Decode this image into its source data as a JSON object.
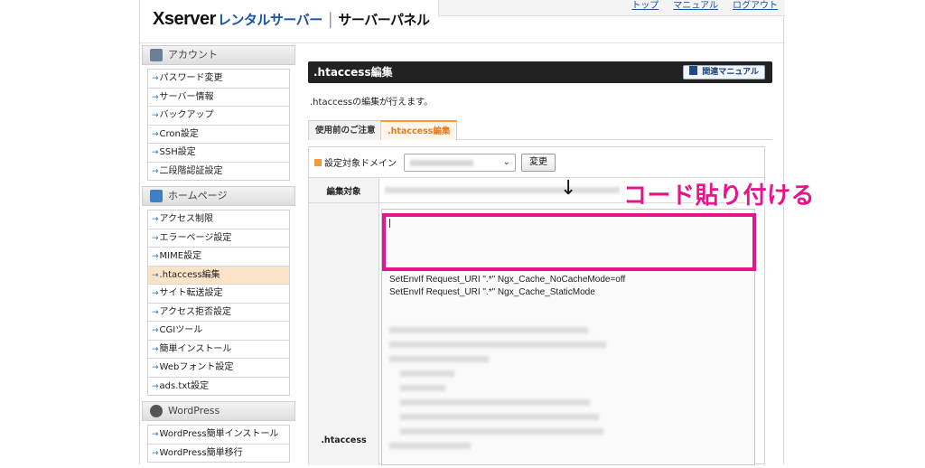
{
  "header": {
    "brand": "Xserver",
    "rental": "レンタルサーバー",
    "separator": "|",
    "panel": "サーバーパネル",
    "nav": [
      "トップ",
      "マニュアル",
      "ログアウト"
    ]
  },
  "sidebar": {
    "groups": [
      {
        "title": "アカウント",
        "icon": "account-icon",
        "items": [
          "パスワード変更",
          "サーバー情報",
          "バックアップ",
          "Cron設定",
          "SSH設定",
          "二段階認証設定"
        ]
      },
      {
        "title": "ホームページ",
        "icon": "homepage-icon",
        "items": [
          "アクセス制限",
          "エラーページ設定",
          "MIME設定",
          ".htaccess編集",
          "サイト転送設定",
          "アクセス拒否設定",
          "CGIツール",
          "簡単インストール",
          "Webフォント設定",
          "ads.txt設定"
        ],
        "active_index": 3
      },
      {
        "title": "WordPress",
        "icon": "wordpress-icon",
        "items": [
          "WordPress簡単インストール",
          "WordPress簡単移行"
        ]
      }
    ]
  },
  "main": {
    "title": ".htaccess編集",
    "manual_button": "関連マニュアル",
    "description": ".htaccessの編集が行えます。",
    "tabs": [
      {
        "label": "使用前のご注意",
        "active": false
      },
      {
        "label": ".htaccess編集",
        "active": true
      }
    ],
    "form": {
      "domain_label": "設定対象ドメイン",
      "change_button": "変更",
      "target_label": "編集対象",
      "htaccess_label": ".htaccess",
      "code_lines": [
        "SetEnvIf Request_URI \".*\" Ngx_Cache_NoCacheMode=off",
        "SetEnvIf Request_URI \".*\" Ngx_Cache_StaticMode"
      ]
    }
  },
  "annotation": {
    "arrow": "↓",
    "text": "コード貼り付ける",
    "color": "#e8148c"
  }
}
